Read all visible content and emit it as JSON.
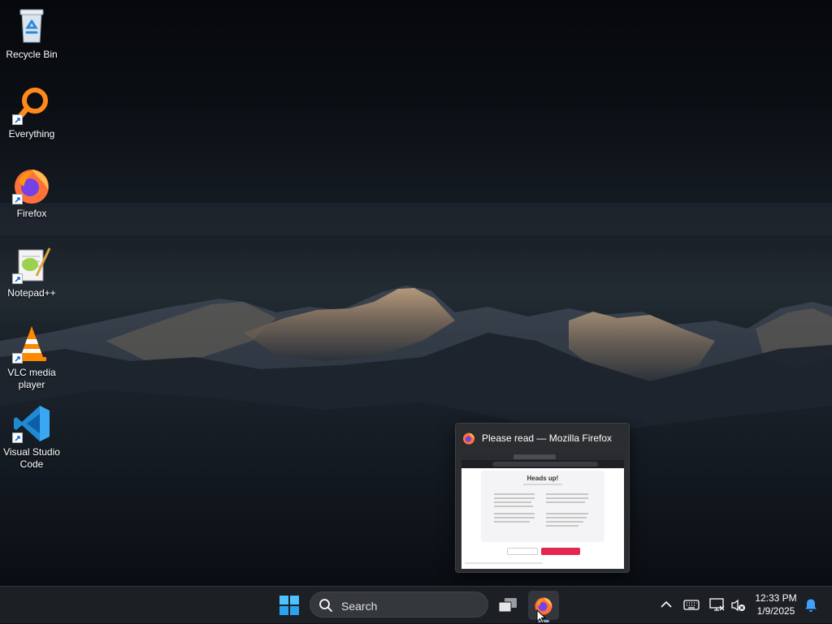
{
  "desktop": {
    "icons": [
      {
        "label": "Recycle Bin",
        "icon": "recycle-bin-icon",
        "shortcut": false
      },
      {
        "label": "Everything",
        "icon": "everything-search-icon",
        "shortcut": true
      },
      {
        "label": "Firefox",
        "icon": "firefox-icon",
        "shortcut": true
      },
      {
        "label": "Notepad++",
        "icon": "notepad-plus-plus-icon",
        "shortcut": true
      },
      {
        "label": "VLC media player",
        "icon": "vlc-cone-icon",
        "shortcut": true
      },
      {
        "label": "Visual Studio Code",
        "icon": "vscode-icon",
        "shortcut": true
      }
    ]
  },
  "taskbar": {
    "search_placeholder": "Search",
    "start_icon": "windows-logo-icon",
    "task_view_icon": "task-view-icon",
    "pinned_app_icon": "firefox-icon",
    "tray_icons": [
      "chevron-up-icon",
      "keyboard-icon",
      "network-icon",
      "volume-muted-icon"
    ],
    "clock": {
      "time": "12:33 PM",
      "date": "1/9/2025"
    },
    "notification_icon": "bell-icon"
  },
  "preview": {
    "title": "Please read — Mozilla Firefox",
    "thumbnail_heading": "Heads up!"
  },
  "colors": {
    "accent_blue": "#3fa0ff",
    "firefox_orange": "#ff7139",
    "thumb_button_red": "#e22850",
    "taskbar_bg": "#1c1f24"
  }
}
